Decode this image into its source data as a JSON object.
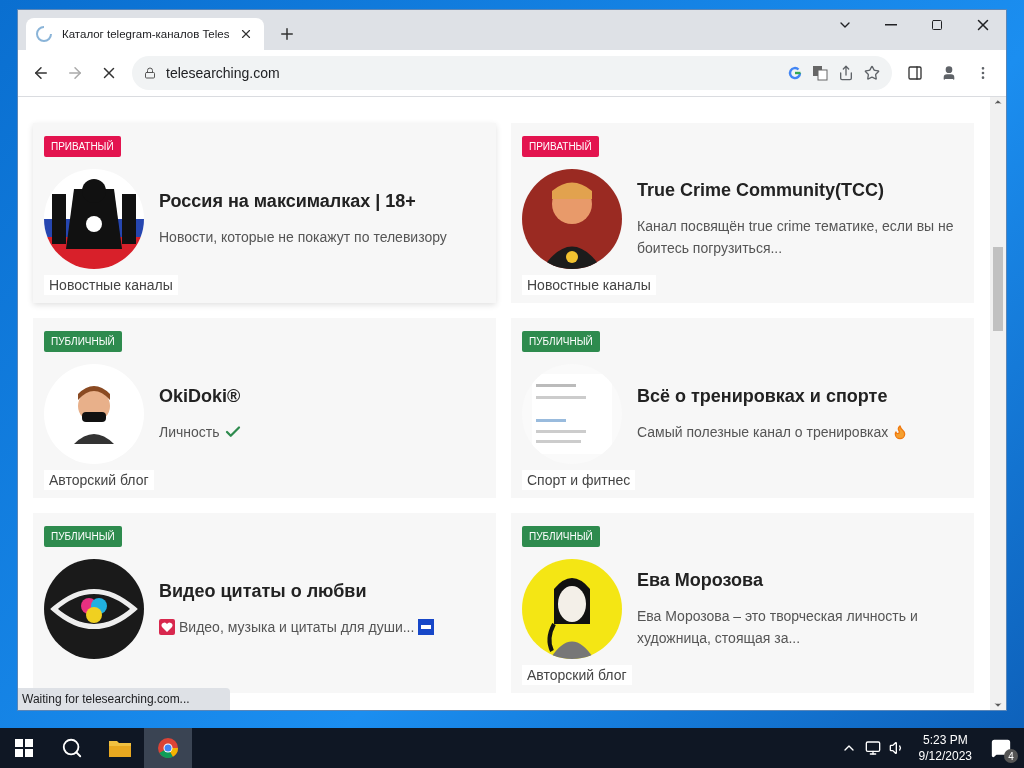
{
  "browser": {
    "tab_title": "Каталог telegram-каналов Teles",
    "url": "telesearching.com",
    "status": "Waiting for telesearching.com..."
  },
  "cards": [
    {
      "kind": "plain",
      "badge": "ПРИВАТНЫЙ",
      "color": "#e3144f",
      "title": "Россия на максималках | 18+",
      "description": "Новости, которые не покажут по телевизору",
      "category": "Новостные каналы"
    },
    {
      "kind": "plain",
      "badge": "ПРИВАТНЫЙ",
      "color": "#e3144f",
      "title": "True Crime Community(TCC)",
      "description": "Канал посвящён true crime тематике, если вы не боитесь погрузиться...",
      "category": "Новостные каналы"
    },
    {
      "kind": "verified",
      "badge": "ПУБЛИЧНЫЙ",
      "color": "#2e8b4e",
      "title": "OkiDoki®",
      "description": "Личность",
      "category": "Авторский блог"
    },
    {
      "kind": "fire",
      "badge": "ПУБЛИЧНЫЙ",
      "color": "#2e8b4e",
      "title": "Всё о тренировках и спорте",
      "description": "Самый полезные канал о тренировках",
      "category": "Спорт и фитнес"
    },
    {
      "kind": "quote",
      "badge": "ПУБЛИЧНЫЙ",
      "color": "#2e8b4e",
      "title": "Видео цитаты о любви",
      "description": "Видео, музыка и цитаты для души..."
    },
    {
      "kind": "plain",
      "badge": "ПУБЛИЧНЫЙ",
      "color": "#2e8b4e",
      "title": "Ева Морозова",
      "description": "Ева Морозова – это творческая личность и художница, стоящая за...",
      "category": "Авторский блог"
    }
  ],
  "taskbar": {
    "time": "5:23 PM",
    "date": "9/12/2023",
    "notifications": "4"
  }
}
